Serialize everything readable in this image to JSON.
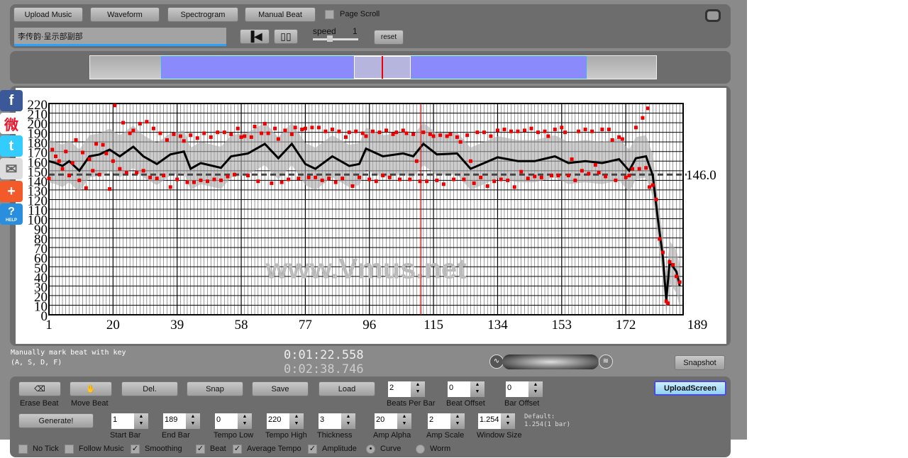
{
  "toolbar": {
    "upload_music": "Upload Music",
    "waveform": "Waveform",
    "spectrogram": "Spectrogram",
    "manual_beat": "Manual Beat",
    "page_scroll": "Page Scroll",
    "song_title": "李传韵·呈示部副部",
    "speed_label": "speed",
    "speed_value": "1",
    "reset": "reset"
  },
  "overview": {
    "playhead_fraction": 0.52
  },
  "social": [
    "facebook-icon",
    "weibo-icon",
    "twitter-icon",
    "mail-icon",
    "plus-icon",
    "help-icon"
  ],
  "social_help_label": "HELP",
  "chart_data": {
    "type": "scatter+line",
    "xlim": [
      1,
      189
    ],
    "ylim": [
      0,
      220
    ],
    "x_ticks": [
      "1",
      "20",
      "39",
      "58",
      "77",
      "96",
      "115",
      "134",
      "153",
      "172",
      "189"
    ],
    "y_ticks": [
      "0",
      "10",
      "20",
      "30",
      "40",
      "50",
      "60",
      "70",
      "80",
      "90",
      "100",
      "110",
      "120",
      "130",
      "140",
      "150",
      "160",
      "170",
      "180",
      "190",
      "200",
      "210",
      "220"
    ],
    "average_tempo": 146.0,
    "average_label": "146.0",
    "cursor_bar": 111.3,
    "watermark": "www.Vmus.net",
    "curve": [
      [
        1,
        160
      ],
      [
        3,
        158
      ],
      [
        5,
        155
      ],
      [
        7,
        160
      ],
      [
        10,
        150
      ],
      [
        13,
        165
      ],
      [
        16,
        167
      ],
      [
        19,
        172
      ],
      [
        22,
        165
      ],
      [
        26,
        175
      ],
      [
        29,
        165
      ],
      [
        33,
        157
      ],
      [
        37,
        167
      ],
      [
        41,
        170
      ],
      [
        43,
        152
      ],
      [
        46,
        158
      ],
      [
        52,
        153
      ],
      [
        55,
        165
      ],
      [
        60,
        168
      ],
      [
        65,
        178
      ],
      [
        69,
        163
      ],
      [
        73,
        178
      ],
      [
        77,
        157
      ],
      [
        80,
        152
      ],
      [
        85,
        165
      ],
      [
        90,
        155
      ],
      [
        93,
        157
      ],
      [
        95,
        173
      ],
      [
        100,
        165
      ],
      [
        106,
        168
      ],
      [
        109,
        165
      ],
      [
        112,
        178
      ],
      [
        116,
        167
      ],
      [
        122,
        168
      ],
      [
        126,
        152
      ],
      [
        130,
        158
      ],
      [
        134,
        164
      ],
      [
        140,
        160
      ],
      [
        145,
        160
      ],
      [
        151,
        165
      ],
      [
        155,
        158
      ],
      [
        160,
        160
      ],
      [
        165,
        158
      ],
      [
        170,
        162
      ],
      [
        173,
        150
      ],
      [
        175,
        163
      ],
      [
        178,
        165
      ],
      [
        180,
        145
      ],
      [
        181.5,
        100
      ],
      [
        183,
        60
      ],
      [
        184,
        15
      ],
      [
        185,
        55
      ],
      [
        187,
        45
      ],
      [
        188,
        30
      ]
    ],
    "band_halfwidth": 22,
    "beats": [
      [
        1,
        142
      ],
      [
        2,
        172
      ],
      [
        3,
        165
      ],
      [
        4,
        160
      ],
      [
        5,
        152
      ],
      [
        6,
        170
      ],
      [
        7,
        145
      ],
      [
        8,
        158
      ],
      [
        9,
        182
      ],
      [
        10,
        140
      ],
      [
        11,
        169
      ],
      [
        12,
        132
      ],
      [
        13,
        162
      ],
      [
        14,
        150
      ],
      [
        15,
        178
      ],
      [
        16,
        146
      ],
      [
        17,
        177
      ],
      [
        18,
        168
      ],
      [
        19,
        131
      ],
      [
        20,
        160
      ],
      [
        20.5,
        218
      ],
      [
        22,
        152
      ],
      [
        23,
        200
      ],
      [
        24,
        148
      ],
      [
        25,
        189
      ],
      [
        26,
        192
      ],
      [
        27,
        148
      ],
      [
        28,
        199
      ],
      [
        29,
        150
      ],
      [
        30,
        201
      ],
      [
        31,
        143
      ],
      [
        32,
        194
      ],
      [
        33,
        142
      ],
      [
        34,
        189
      ],
      [
        35,
        145
      ],
      [
        36,
        182
      ],
      [
        37,
        133
      ],
      [
        38,
        188
      ],
      [
        39,
        141
      ],
      [
        40,
        186
      ],
      [
        41,
        181
      ],
      [
        42,
        138
      ],
      [
        43,
        187
      ],
      [
        44,
        138
      ],
      [
        45,
        184
      ],
      [
        46,
        140
      ],
      [
        47,
        189
      ],
      [
        48,
        139
      ],
      [
        49,
        185
      ],
      [
        50,
        141
      ],
      [
        51,
        190
      ],
      [
        52,
        140
      ],
      [
        53,
        190
      ],
      [
        54,
        144
      ],
      [
        55,
        188
      ],
      [
        56,
        146
      ],
      [
        57,
        194
      ],
      [
        58,
        185
      ],
      [
        59,
        186
      ],
      [
        60,
        145
      ],
      [
        61,
        185
      ],
      [
        62,
        196
      ],
      [
        63,
        139
      ],
      [
        64,
        189
      ],
      [
        65,
        199
      ],
      [
        66,
        189
      ],
      [
        67,
        137
      ],
      [
        68,
        194
      ],
      [
        69,
        183
      ],
      [
        70,
        138
      ],
      [
        71,
        192
      ],
      [
        72,
        141
      ],
      [
        73,
        188
      ],
      [
        74,
        195
      ],
      [
        75,
        142
      ],
      [
        76,
        193
      ],
      [
        77,
        194
      ],
      [
        78,
        143
      ],
      [
        79,
        195
      ],
      [
        80,
        143
      ],
      [
        81,
        195
      ],
      [
        82,
        140
      ],
      [
        83,
        191
      ],
      [
        84,
        142
      ],
      [
        85,
        193
      ],
      [
        86,
        138
      ],
      [
        87,
        191
      ],
      [
        88,
        142
      ],
      [
        89,
        185
      ],
      [
        90,
        190
      ],
      [
        91,
        134
      ],
      [
        92,
        191
      ],
      [
        93,
        143
      ],
      [
        94,
        189
      ],
      [
        95,
        186
      ],
      [
        96,
        141
      ],
      [
        97,
        191
      ],
      [
        98,
        139
      ],
      [
        99,
        190
      ],
      [
        100,
        145
      ],
      [
        101,
        192
      ],
      [
        102,
        143
      ],
      [
        103,
        188
      ],
      [
        104,
        190
      ],
      [
        105,
        141
      ],
      [
        106,
        192
      ],
      [
        107,
        189
      ],
      [
        108,
        141
      ],
      [
        109,
        188
      ],
      [
        110,
        160
      ],
      [
        111,
        139
      ],
      [
        112,
        190
      ],
      [
        113,
        139
      ],
      [
        114,
        188
      ],
      [
        115,
        186
      ],
      [
        116,
        140
      ],
      [
        117,
        187
      ],
      [
        118,
        136
      ],
      [
        119,
        186
      ],
      [
        120,
        188
      ],
      [
        121,
        141
      ],
      [
        122,
        185
      ],
      [
        123,
        180
      ],
      [
        124,
        141
      ],
      [
        125,
        187
      ],
      [
        126,
        160
      ],
      [
        127,
        137
      ],
      [
        128,
        190
      ],
      [
        129,
        143
      ],
      [
        130,
        190
      ],
      [
        131,
        134
      ],
      [
        132,
        186
      ],
      [
        133,
        139
      ],
      [
        134,
        192
      ],
      [
        135,
        141
      ],
      [
        136,
        193
      ],
      [
        137,
        140
      ],
      [
        138,
        191
      ],
      [
        139,
        133
      ],
      [
        140,
        191
      ],
      [
        141,
        149
      ],
      [
        142,
        192
      ],
      [
        143,
        142
      ],
      [
        144,
        194
      ],
      [
        145,
        144
      ],
      [
        146,
        190
      ],
      [
        147,
        143
      ],
      [
        148,
        191
      ],
      [
        149,
        186
      ],
      [
        150,
        145
      ],
      [
        151,
        193
      ],
      [
        152,
        145
      ],
      [
        153,
        195
      ],
      [
        154,
        190
      ],
      [
        155,
        145
      ],
      [
        156,
        162
      ],
      [
        157,
        140
      ],
      [
        158,
        191
      ],
      [
        159,
        150
      ],
      [
        160,
        193
      ],
      [
        161,
        147
      ],
      [
        162,
        191
      ],
      [
        163,
        156
      ],
      [
        164,
        148
      ],
      [
        165,
        193
      ],
      [
        166,
        144
      ],
      [
        167,
        193
      ],
      [
        168,
        182
      ],
      [
        169,
        140
      ],
      [
        170,
        185
      ],
      [
        171,
        183
      ],
      [
        172,
        143
      ],
      [
        173,
        145
      ],
      [
        174,
        152
      ],
      [
        175,
        195
      ],
      [
        176,
        152
      ],
      [
        177,
        205
      ],
      [
        178,
        153
      ],
      [
        178.5,
        215
      ],
      [
        179,
        133
      ],
      [
        180,
        135
      ],
      [
        181,
        120
      ],
      [
        182,
        79
      ],
      [
        183,
        65
      ],
      [
        184,
        14
      ],
      [
        184.5,
        12
      ],
      [
        185,
        55
      ],
      [
        186,
        52
      ],
      [
        187,
        40
      ],
      [
        188,
        34
      ]
    ]
  },
  "status": {
    "hint_line1": "Manually mark beat with key",
    "hint_line2": "(A, S, D, F)",
    "current_time": "0:01:22.558",
    "total_time": "0:02:38.746",
    "snapshot": "Snapshot"
  },
  "controls": {
    "erase_beat": "Erase Beat",
    "move_beat": "Move Beat",
    "del": "Del.",
    "snap": "Snap",
    "save": "Save",
    "load": "Load",
    "upload_screen": "UploadScreen",
    "generate": "Generate!",
    "beats_per_bar": {
      "label": "Beats Per Bar",
      "value": "2"
    },
    "beat_offset": {
      "label": "Beat Offset",
      "value": "0"
    },
    "bar_offset": {
      "label": "Bar Offset",
      "value": "0"
    },
    "start_bar": {
      "label": "Start Bar",
      "value": "1"
    },
    "end_bar": {
      "label": "End Bar",
      "value": "189"
    },
    "tempo_low": {
      "label": "Tempo Low",
      "value": "0"
    },
    "tempo_high": {
      "label": "Tempo High",
      "value": "220"
    },
    "thickness": {
      "label": "Thickness",
      "value": "3"
    },
    "amp_alpha": {
      "label": "Amp Alpha",
      "value": "20"
    },
    "amp_scale": {
      "label": "Amp Scale",
      "value": "2"
    },
    "window_size": {
      "label": "Window Size",
      "value": "1.254"
    },
    "default_line1": "Default:",
    "default_line2": "1.254(1 bar)",
    "no_tick": {
      "label": "No Tick",
      "checked": false
    },
    "follow_music": {
      "label": "Follow Music",
      "checked": false
    },
    "smoothing": {
      "label": "Smoothing",
      "checked": true
    },
    "beat": {
      "label": "Beat",
      "checked": true
    },
    "average_tempo": {
      "label": "Average Tempo",
      "checked": true
    },
    "amplitude": {
      "label": "Amplitude",
      "checked": true
    },
    "curve": {
      "label": "Curve",
      "selected": true
    },
    "worm": {
      "label": "Worm",
      "selected": false
    }
  }
}
